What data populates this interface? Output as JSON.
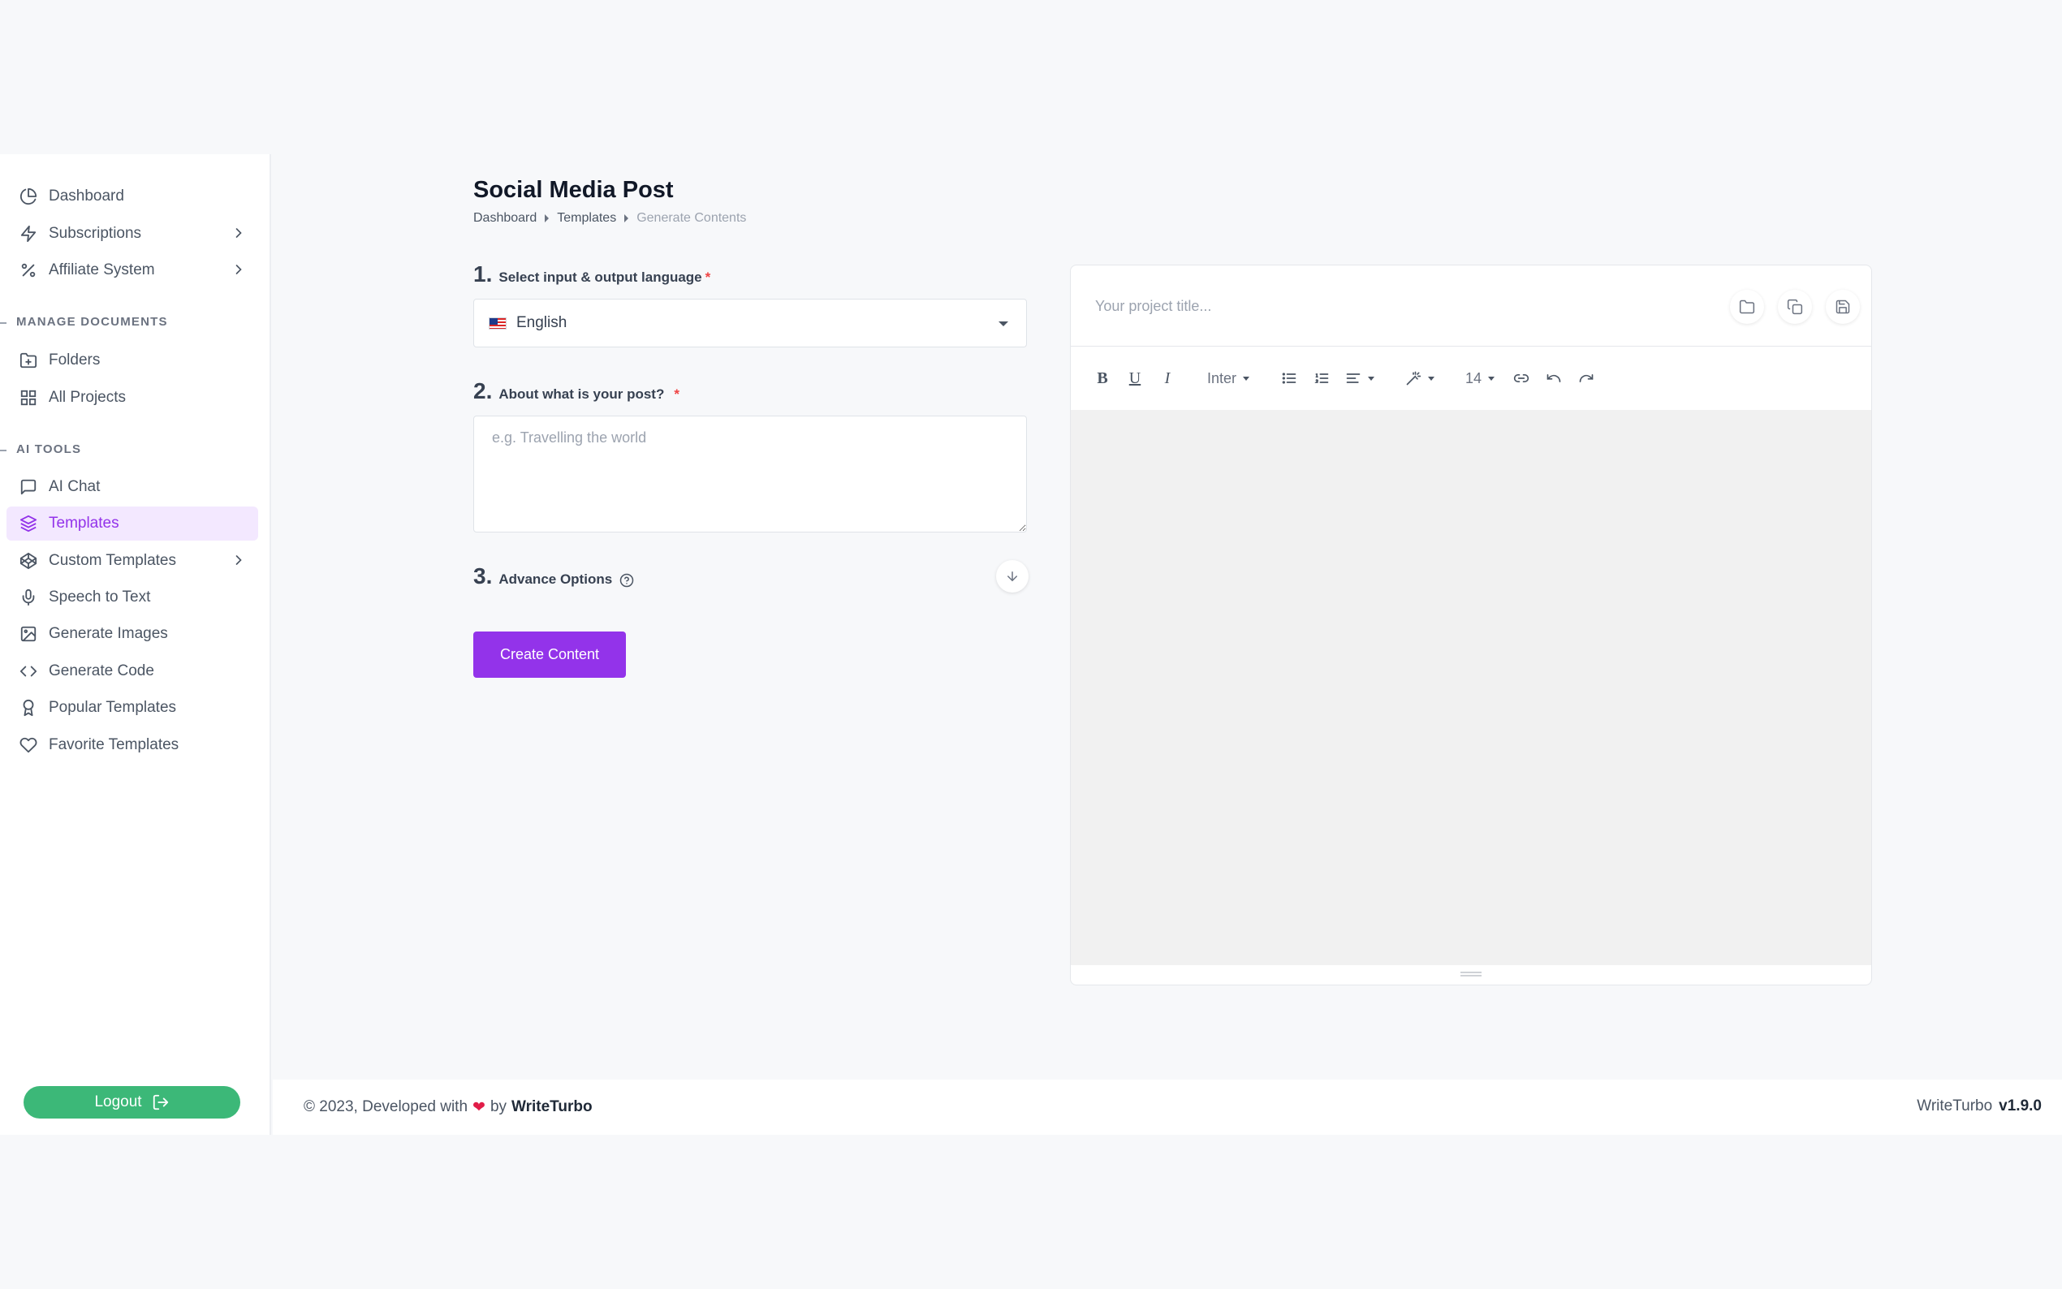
{
  "sidebar": {
    "items": [
      {
        "label": "Dashboard",
        "icon": "pie-chart-icon"
      },
      {
        "label": "Subscriptions",
        "icon": "bolt-icon"
      },
      {
        "label": "Affiliate System",
        "icon": "percent-icon"
      }
    ],
    "manage_documents": {
      "label": "MANAGE DOCUMENTS",
      "items": [
        {
          "label": "Folders",
          "icon": "folder-plus-icon"
        },
        {
          "label": "All Projects",
          "icon": "grid-icon"
        }
      ]
    },
    "ai_tools": {
      "label": "AI TOOLS",
      "items": [
        {
          "label": "AI Chat",
          "icon": "chat-icon"
        },
        {
          "label": "Templates",
          "icon": "layers-icon"
        },
        {
          "label": "Custom Templates",
          "icon": "codepen-icon"
        },
        {
          "label": "Speech to Text",
          "icon": "microphone-icon"
        },
        {
          "label": "Generate Images",
          "icon": "image-icon"
        },
        {
          "label": "Generate Code",
          "icon": "code-icon"
        },
        {
          "label": "Popular Templates",
          "icon": "award-icon"
        },
        {
          "label": "Favorite Templates",
          "icon": "heart-icon"
        }
      ]
    },
    "logout_label": "Logout"
  },
  "page": {
    "title": "Social Media Post",
    "breadcrumb": [
      "Dashboard",
      "Templates",
      "Generate Contents"
    ]
  },
  "form": {
    "step1": {
      "num": "1.",
      "label": "Select input & output language",
      "required": "*",
      "value": "English"
    },
    "step2": {
      "num": "2.",
      "label": "About what is your post?",
      "required": "*",
      "placeholder": "e.g. Travelling the world"
    },
    "step3": {
      "num": "3.",
      "label": "Advance Options"
    },
    "submit_label": "Create Content"
  },
  "editor": {
    "title_placeholder": "Your project title...",
    "font_name": "Inter",
    "font_size": "14"
  },
  "footer": {
    "copyright": "© 2023, Developed with",
    "by": "by",
    "brand": "WriteTurbo",
    "app_name": "WriteTurbo",
    "version": "v1.9.0"
  },
  "colors": {
    "accent": "#9333ea",
    "active_bg": "#f3e8ff",
    "logout": "#3cb878"
  }
}
